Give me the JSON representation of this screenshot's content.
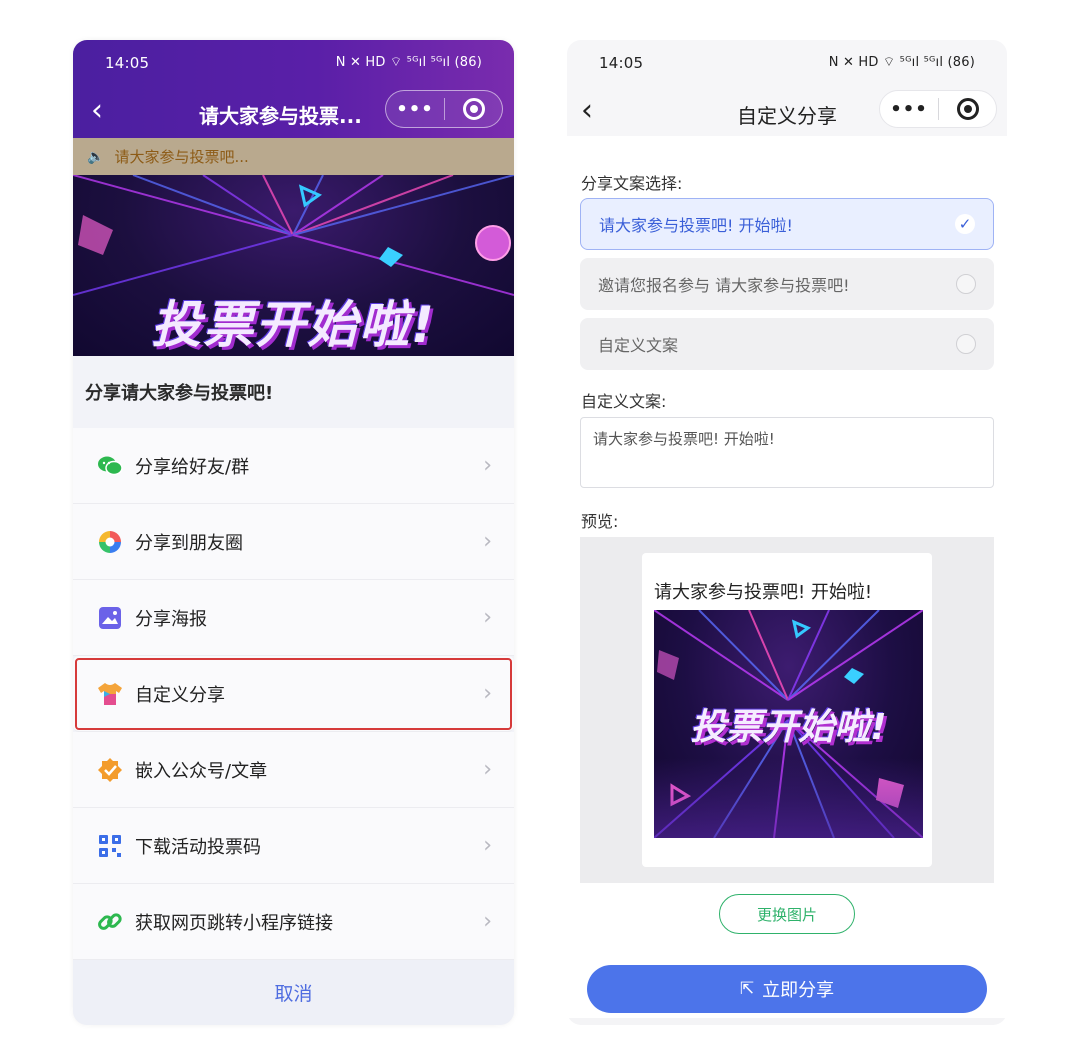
{
  "left_screen": {
    "status_bar": {
      "time": "14:05",
      "icons": "N ✕ HD ⌔ ⁵ᴳıl ⁵ᴳıl (86)"
    },
    "nav": {
      "title": "请大家参与投票...",
      "more": "•••"
    },
    "notice": {
      "text": "请大家参与投票吧..."
    },
    "banner": {
      "title": "投票开始啦!"
    },
    "share_heading": "分享请大家参与投票吧!",
    "menu": [
      {
        "label": "分享给好友/群",
        "icon": "wechat-icon"
      },
      {
        "label": "分享到朋友圈",
        "icon": "moments-icon"
      },
      {
        "label": "分享海报",
        "icon": "poster-icon"
      },
      {
        "label": "自定义分享",
        "icon": "shirt-icon",
        "highlighted": true
      },
      {
        "label": "嵌入公众号/文章",
        "icon": "verified-badge-icon"
      },
      {
        "label": "下载活动投票码",
        "icon": "qr-code-icon"
      },
      {
        "label": "获取网页跳转小程序链接",
        "icon": "link-icon"
      }
    ],
    "cancel": "取消"
  },
  "right_screen": {
    "status_bar": {
      "time": "14:05",
      "icons": "N ✕ HD ⌔ ⁵ᴳıl ⁵ᴳıl (86)"
    },
    "nav": {
      "title": "自定义分享",
      "more": "•••"
    },
    "copy_select_label": "分享文案选择:",
    "options": [
      {
        "text": "请大家参与投票吧!  开始啦!",
        "selected": true
      },
      {
        "text": "邀请您报名参与 请大家参与投票吧!",
        "selected": false
      },
      {
        "text": "自定义文案",
        "selected": false
      }
    ],
    "custom_label": "自定义文案:",
    "custom_value": "请大家参与投票吧!  开始啦!",
    "preview_label": "预览:",
    "preview": {
      "text": "请大家参与投票吧!  开始啦!",
      "image_title": "投票开始啦!"
    },
    "change_image": "更换图片",
    "share_now": "立即分享"
  },
  "colors": {
    "accent_blue": "#4c74ea",
    "highlight_red": "#d63a3a",
    "green": "#2fb26b",
    "purple_header": "#5a1fa8"
  }
}
